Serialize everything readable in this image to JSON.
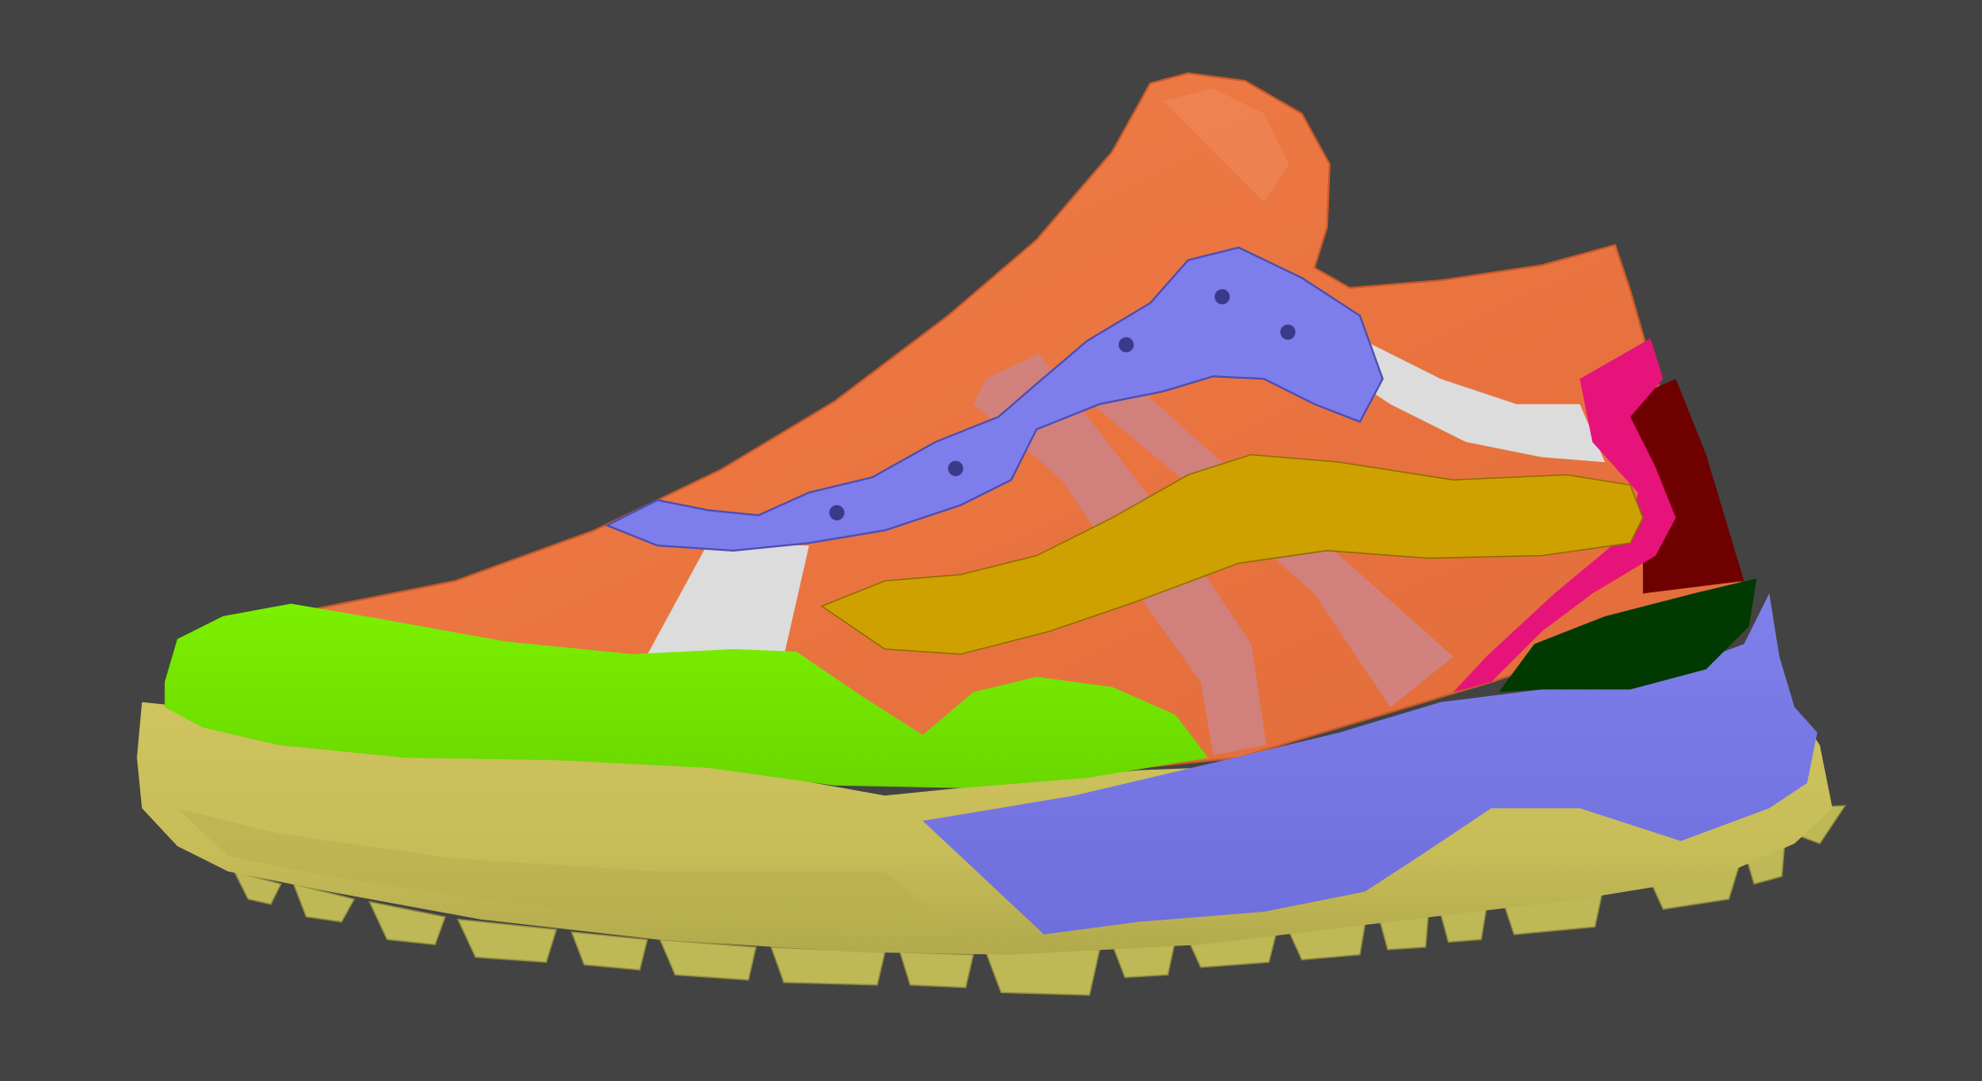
{
  "scene": {
    "background": "#434343",
    "subject": "sneaker-3d-model",
    "parts": {
      "upper": "#EA7440",
      "toe_cap": "#76EC00",
      "midsole": "#C8BE5A",
      "outsole_lugs": "#BEB856",
      "side_panel": "#7E7EEA",
      "lace_eyestay": "#7D7DEB",
      "swoosh_band": "#CFA100",
      "pink_stripes": "#D08282",
      "white_trim": "#DCDCDC",
      "heel_magenta": "#E6137A",
      "heel_maroon": "#6E0000",
      "heel_green": "#003A00"
    }
  }
}
